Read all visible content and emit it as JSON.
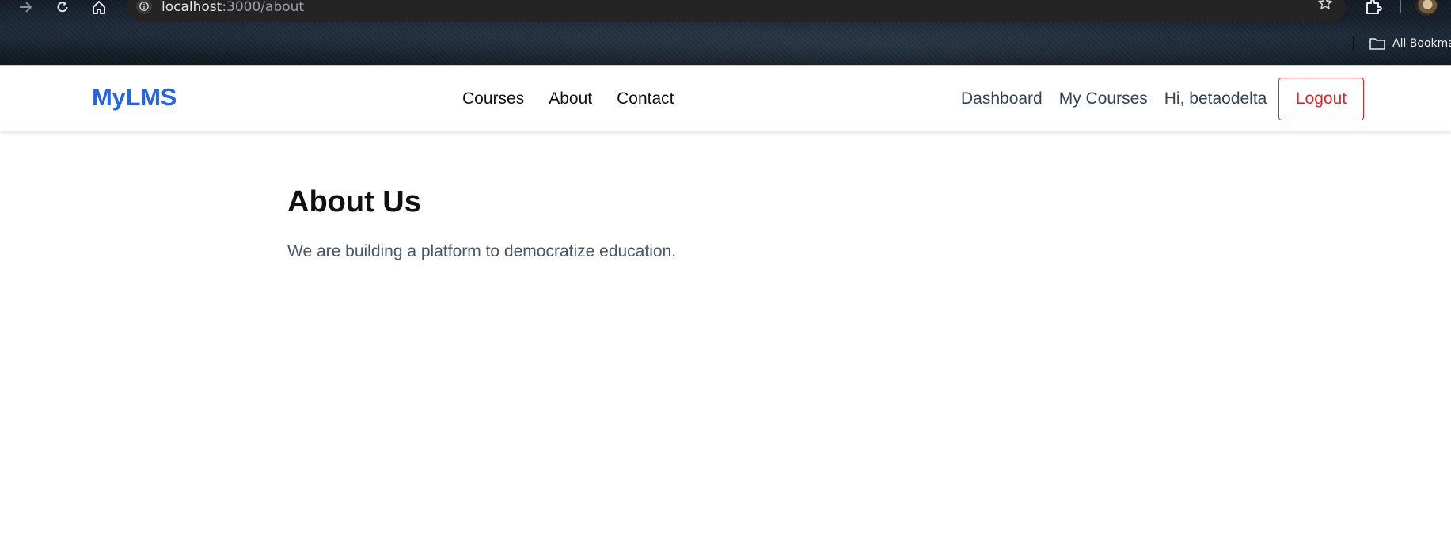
{
  "browser": {
    "url_host": "localhost",
    "url_path": ":3000/about",
    "bookmarks_label": "All Bookmarks"
  },
  "header": {
    "brand": "MyLMS",
    "nav": {
      "courses": "Courses",
      "about": "About",
      "contact": "Contact"
    },
    "user_nav": {
      "dashboard": "Dashboard",
      "my_courses": "My Courses",
      "greeting": "Hi, betaodelta",
      "logout": "Logout"
    }
  },
  "main": {
    "title": "About Us",
    "description": "We are building a platform to democratize education."
  },
  "colors": {
    "brand": "#2563eb",
    "logout": "#dc2626"
  },
  "icons": [
    "forward-icon",
    "reload-icon",
    "home-icon",
    "info-icon",
    "star-icon",
    "extensions-icon",
    "folder-icon"
  ]
}
